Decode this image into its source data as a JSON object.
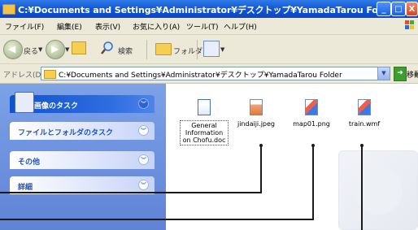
{
  "window": {
    "title": "C:¥Documents and Settings¥Administrator¥デスクトップ¥YamadaTarou Folder",
    "min_symbol": "_",
    "max_symbol": "□",
    "close_symbol": "X"
  },
  "menu": [
    {
      "label": "ファイル(F)"
    },
    {
      "label": "編集(E)"
    },
    {
      "label": "表示(V)"
    },
    {
      "label": "お気に入り(A)"
    },
    {
      "label": "ツール(T)"
    },
    {
      "label": "ヘルプ(H)"
    }
  ],
  "toolbar": {
    "back_label": "戻る",
    "search_label": "検索",
    "folders_label": "フォルダ"
  },
  "address": {
    "label": "アドレス(D)",
    "value": "C:¥Documents and Settings¥Administrator¥デスクトップ¥YamadaTarou Folder",
    "go_label": "移動"
  },
  "taskpane": {
    "sections": [
      {
        "title": "画像のタスク"
      },
      {
        "title": "ファイルとフォルダのタスク"
      },
      {
        "title": "その他"
      },
      {
        "title": "詳細"
      }
    ]
  },
  "files": [
    {
      "name": "General Information on Chofu.doc",
      "icon": "word-document-icon"
    },
    {
      "name": "jindaiji.jpeg",
      "icon": "jpeg-image-icon"
    },
    {
      "name": "map01.png",
      "icon": "png-image-icon"
    },
    {
      "name": "train.wmf",
      "icon": "wmf-image-icon"
    }
  ],
  "colors": {
    "title_bar": "#1459d6",
    "task_pane": "#6b8fdc",
    "callout_line": "#1a1a1a"
  }
}
